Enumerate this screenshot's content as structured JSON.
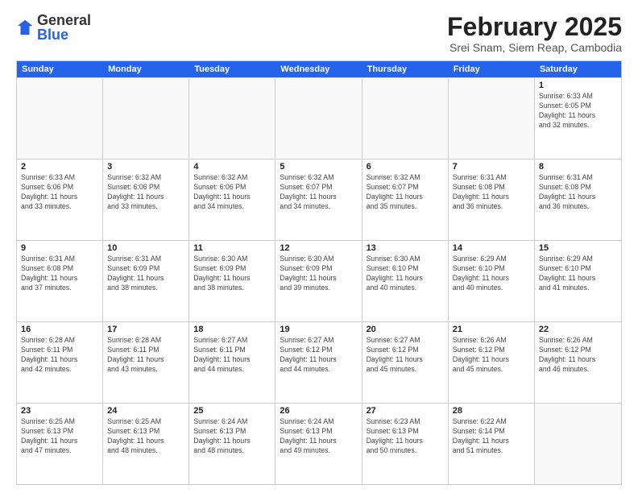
{
  "logo": {
    "general": "General",
    "blue": "Blue"
  },
  "title": "February 2025",
  "location": "Srei Snam, Siem Reap, Cambodia",
  "days_header": [
    "Sunday",
    "Monday",
    "Tuesday",
    "Wednesday",
    "Thursday",
    "Friday",
    "Saturday"
  ],
  "weeks": [
    [
      {
        "day": "",
        "info": ""
      },
      {
        "day": "",
        "info": ""
      },
      {
        "day": "",
        "info": ""
      },
      {
        "day": "",
        "info": ""
      },
      {
        "day": "",
        "info": ""
      },
      {
        "day": "",
        "info": ""
      },
      {
        "day": "1",
        "info": "Sunrise: 6:33 AM\nSunset: 6:05 PM\nDaylight: 11 hours\nand 32 minutes."
      }
    ],
    [
      {
        "day": "2",
        "info": "Sunrise: 6:33 AM\nSunset: 6:06 PM\nDaylight: 11 hours\nand 33 minutes."
      },
      {
        "day": "3",
        "info": "Sunrise: 6:32 AM\nSunset: 6:06 PM\nDaylight: 11 hours\nand 33 minutes."
      },
      {
        "day": "4",
        "info": "Sunrise: 6:32 AM\nSunset: 6:06 PM\nDaylight: 11 hours\nand 34 minutes."
      },
      {
        "day": "5",
        "info": "Sunrise: 6:32 AM\nSunset: 6:07 PM\nDaylight: 11 hours\nand 34 minutes."
      },
      {
        "day": "6",
        "info": "Sunrise: 6:32 AM\nSunset: 6:07 PM\nDaylight: 11 hours\nand 35 minutes."
      },
      {
        "day": "7",
        "info": "Sunrise: 6:31 AM\nSunset: 6:08 PM\nDaylight: 11 hours\nand 36 minutes."
      },
      {
        "day": "8",
        "info": "Sunrise: 6:31 AM\nSunset: 6:08 PM\nDaylight: 11 hours\nand 36 minutes."
      }
    ],
    [
      {
        "day": "9",
        "info": "Sunrise: 6:31 AM\nSunset: 6:08 PM\nDaylight: 11 hours\nand 37 minutes."
      },
      {
        "day": "10",
        "info": "Sunrise: 6:31 AM\nSunset: 6:09 PM\nDaylight: 11 hours\nand 38 minutes."
      },
      {
        "day": "11",
        "info": "Sunrise: 6:30 AM\nSunset: 6:09 PM\nDaylight: 11 hours\nand 38 minutes."
      },
      {
        "day": "12",
        "info": "Sunrise: 6:30 AM\nSunset: 6:09 PM\nDaylight: 11 hours\nand 39 minutes."
      },
      {
        "day": "13",
        "info": "Sunrise: 6:30 AM\nSunset: 6:10 PM\nDaylight: 11 hours\nand 40 minutes."
      },
      {
        "day": "14",
        "info": "Sunrise: 6:29 AM\nSunset: 6:10 PM\nDaylight: 11 hours\nand 40 minutes."
      },
      {
        "day": "15",
        "info": "Sunrise: 6:29 AM\nSunset: 6:10 PM\nDaylight: 11 hours\nand 41 minutes."
      }
    ],
    [
      {
        "day": "16",
        "info": "Sunrise: 6:28 AM\nSunset: 6:11 PM\nDaylight: 11 hours\nand 42 minutes."
      },
      {
        "day": "17",
        "info": "Sunrise: 6:28 AM\nSunset: 6:11 PM\nDaylight: 11 hours\nand 43 minutes."
      },
      {
        "day": "18",
        "info": "Sunrise: 6:27 AM\nSunset: 6:11 PM\nDaylight: 11 hours\nand 44 minutes."
      },
      {
        "day": "19",
        "info": "Sunrise: 6:27 AM\nSunset: 6:12 PM\nDaylight: 11 hours\nand 44 minutes."
      },
      {
        "day": "20",
        "info": "Sunrise: 6:27 AM\nSunset: 6:12 PM\nDaylight: 11 hours\nand 45 minutes."
      },
      {
        "day": "21",
        "info": "Sunrise: 6:26 AM\nSunset: 6:12 PM\nDaylight: 11 hours\nand 45 minutes."
      },
      {
        "day": "22",
        "info": "Sunrise: 6:26 AM\nSunset: 6:12 PM\nDaylight: 11 hours\nand 46 minutes."
      }
    ],
    [
      {
        "day": "23",
        "info": "Sunrise: 6:25 AM\nSunset: 6:13 PM\nDaylight: 11 hours\nand 47 minutes."
      },
      {
        "day": "24",
        "info": "Sunrise: 6:25 AM\nSunset: 6:13 PM\nDaylight: 11 hours\nand 48 minutes."
      },
      {
        "day": "25",
        "info": "Sunrise: 6:24 AM\nSunset: 6:13 PM\nDaylight: 11 hours\nand 48 minutes."
      },
      {
        "day": "26",
        "info": "Sunrise: 6:24 AM\nSunset: 6:13 PM\nDaylight: 11 hours\nand 49 minutes."
      },
      {
        "day": "27",
        "info": "Sunrise: 6:23 AM\nSunset: 6:13 PM\nDaylight: 11 hours\nand 50 minutes."
      },
      {
        "day": "28",
        "info": "Sunrise: 6:22 AM\nSunset: 6:14 PM\nDaylight: 11 hours\nand 51 minutes."
      },
      {
        "day": "",
        "info": ""
      }
    ]
  ]
}
